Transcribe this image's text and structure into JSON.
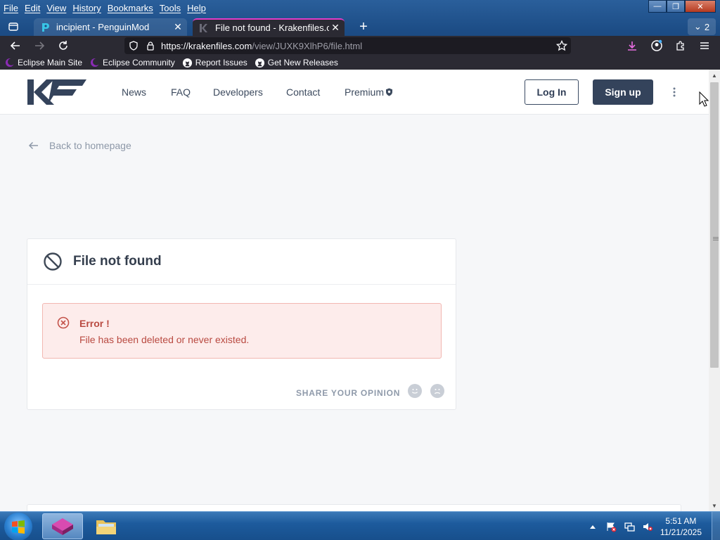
{
  "browser": {
    "menu": [
      "File",
      "Edit",
      "View",
      "History",
      "Bookmarks",
      "Tools",
      "Help"
    ],
    "tabs": [
      {
        "title": "incipient - PenguinMod",
        "icon": "penguinmod-icon",
        "active": false
      },
      {
        "title": "File not found - Krakenfiles.com",
        "icon": "krakenfiles-icon",
        "active": true
      }
    ],
    "tab_count": "2",
    "url": {
      "host": "https://krakenfiles.com",
      "path": "/view/JUXK9XlhP6/file.html"
    },
    "bookmarks": [
      {
        "label": "Eclipse Main Site",
        "icon": "eclipse-icon"
      },
      {
        "label": "Eclipse Community",
        "icon": "eclipse-icon"
      },
      {
        "label": "Report Issues",
        "icon": "github-icon"
      },
      {
        "label": "Get New Releases",
        "icon": "github-icon"
      }
    ]
  },
  "site": {
    "nav": [
      "News",
      "FAQ",
      "Developers",
      "Contact",
      "Premium"
    ],
    "login": "Log In",
    "signup": "Sign up",
    "back": "Back to homepage",
    "card": {
      "title": "File not found",
      "alert_title": "Error !",
      "alert_message": "File has been deleted or never existed.",
      "share": "SHARE YOUR OPINION"
    }
  },
  "taskbar": {
    "time": "5:51 AM",
    "date": "11/21/2025"
  },
  "colors": {
    "accent": "#34435b",
    "error": "#b94a41",
    "error_bg": "#fdeceb",
    "tab_accent": "#e23cc7"
  }
}
